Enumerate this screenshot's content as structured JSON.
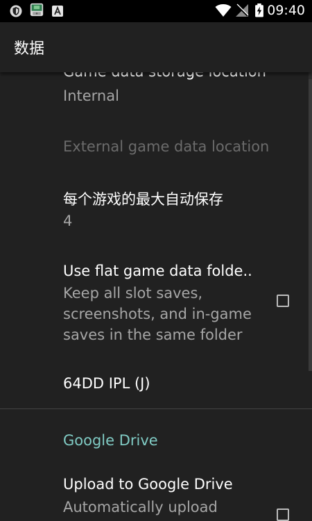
{
  "status_bar": {
    "time": "09:40",
    "icons": [
      "shield-notification-icon",
      "game-app-notification-icon",
      "a-notification-icon",
      "wifi-icon",
      "no-signal-icon",
      "battery-charging-icon"
    ]
  },
  "app_bar": {
    "title": "数据"
  },
  "preferences": [
    {
      "title": "Game data storage location",
      "summary": "Internal",
      "enabled": true
    },
    {
      "title": "External game data location",
      "enabled": false
    },
    {
      "title": "每个游戏的最大自动保存",
      "summary": "4",
      "enabled": true
    },
    {
      "title": "Use flat game data folde..",
      "summary_lines": [
        "Keep all slot saves,",
        "screenshots, and in-game",
        "saves in the same folder"
      ],
      "checked": false,
      "enabled": true
    },
    {
      "title": "64DD IPL (J)",
      "enabled": true
    },
    {
      "category": "Google Drive"
    },
    {
      "title": "Upload to Google Drive",
      "summary_lines": [
        "Automatically upload"
      ],
      "checked": false,
      "enabled": true
    }
  ],
  "colors": {
    "background": "#212121",
    "status_bar": "#000000",
    "category_accent": "#80cbc4",
    "summary_text": "#a6a6a6",
    "disabled_text": "#6b6b6b"
  }
}
